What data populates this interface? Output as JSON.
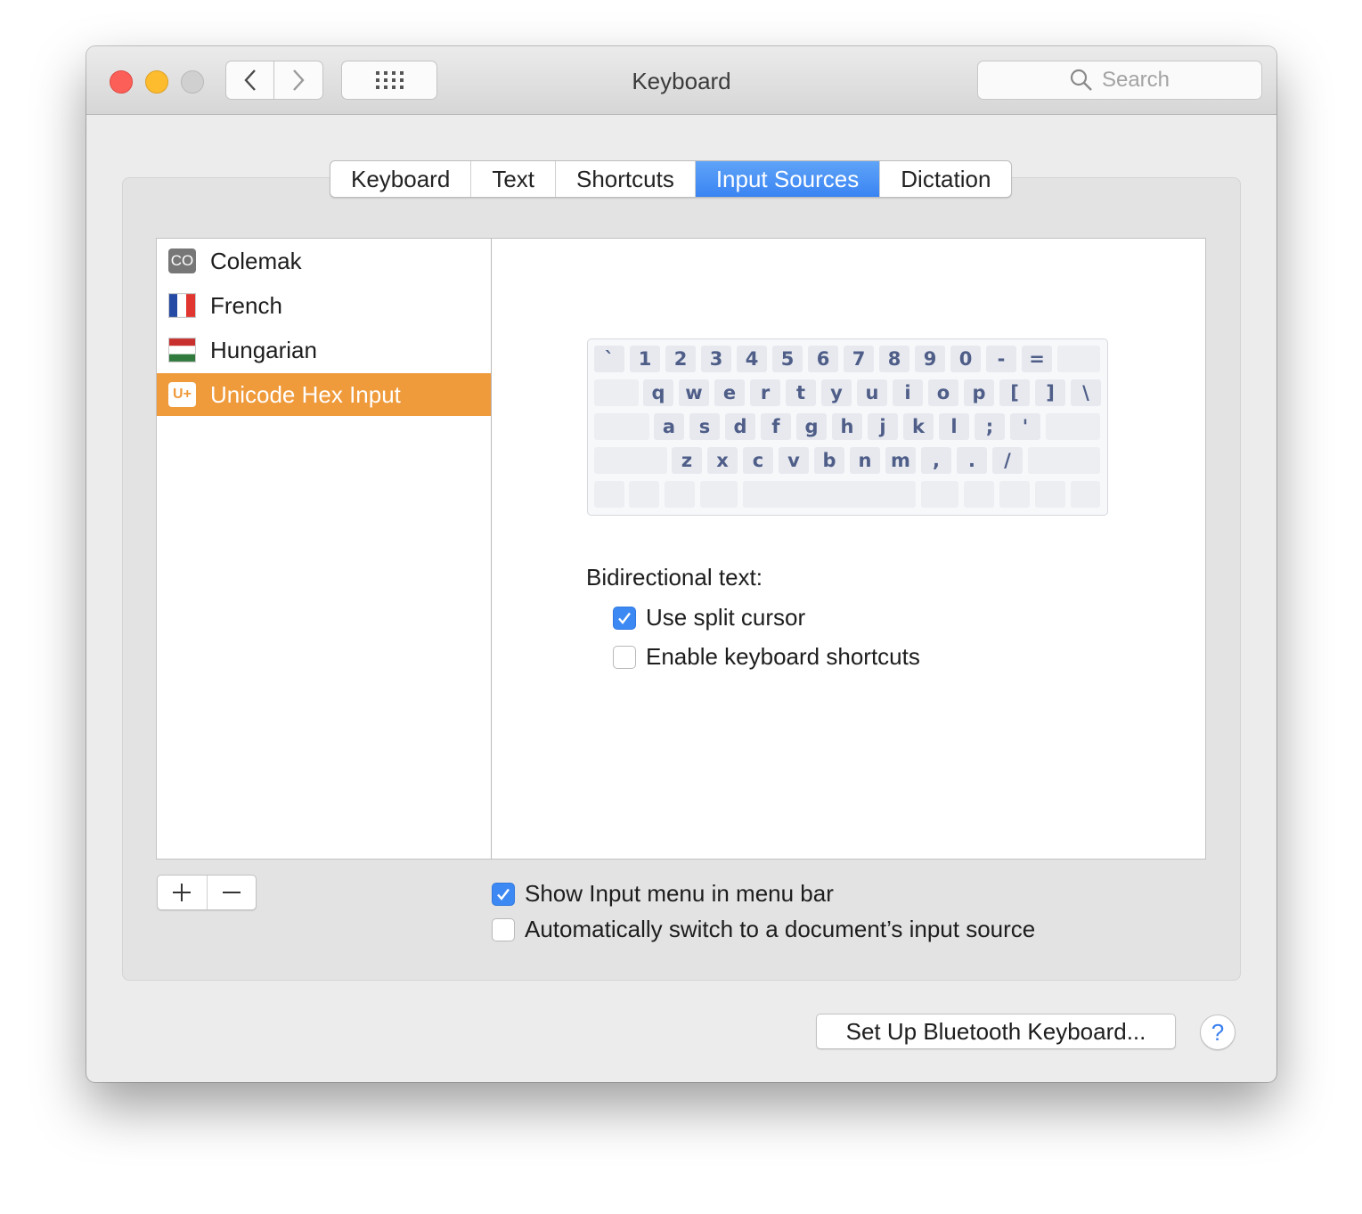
{
  "window": {
    "title": "Keyboard"
  },
  "toolbar": {
    "search_placeholder": "Search"
  },
  "tabs": [
    {
      "label": "Keyboard",
      "active": false
    },
    {
      "label": "Text",
      "active": false
    },
    {
      "label": "Shortcuts",
      "active": false
    },
    {
      "label": "Input Sources",
      "active": true
    },
    {
      "label": "Dictation",
      "active": false
    }
  ],
  "sources": [
    {
      "label": "Colemak",
      "icon": "colemak-icon",
      "icon_text": "CO",
      "selected": false
    },
    {
      "label": "French",
      "icon": "french-flag-icon",
      "selected": false
    },
    {
      "label": "Hungarian",
      "icon": "hungarian-flag-icon",
      "selected": false
    },
    {
      "label": "Unicode Hex Input",
      "icon": "unicode-hex-icon",
      "icon_text": "U+",
      "selected": true
    }
  ],
  "keyboard_preview": {
    "row1": [
      "`",
      "1",
      "2",
      "3",
      "4",
      "5",
      "6",
      "7",
      "8",
      "9",
      "0",
      "-",
      "="
    ],
    "row2": [
      "q",
      "w",
      "e",
      "r",
      "t",
      "y",
      "u",
      "i",
      "o",
      "p",
      "[",
      "]",
      "\\"
    ],
    "row3": [
      "a",
      "s",
      "d",
      "f",
      "g",
      "h",
      "j",
      "k",
      "l",
      ";",
      "'"
    ],
    "row4": [
      "z",
      "x",
      "c",
      "v",
      "b",
      "n",
      "m",
      ",",
      ".",
      "/"
    ]
  },
  "bidi": {
    "label": "Bidirectional text:",
    "split_cursor": {
      "label": "Use split cursor",
      "checked": true
    },
    "keyboard_shortcuts": {
      "label": "Enable keyboard shortcuts",
      "checked": false
    }
  },
  "options": {
    "show_input_menu": {
      "label": "Show Input menu in menu bar",
      "checked": true
    },
    "auto_switch": {
      "label": "Automatically switch to a document’s input source",
      "checked": false
    }
  },
  "buttons": {
    "bluetooth": "Set Up Bluetooth Keyboard...",
    "help": "?"
  },
  "colors": {
    "accent": "#3d89f4",
    "selection": "#ef9a3b",
    "key_text": "#4f5e88"
  }
}
